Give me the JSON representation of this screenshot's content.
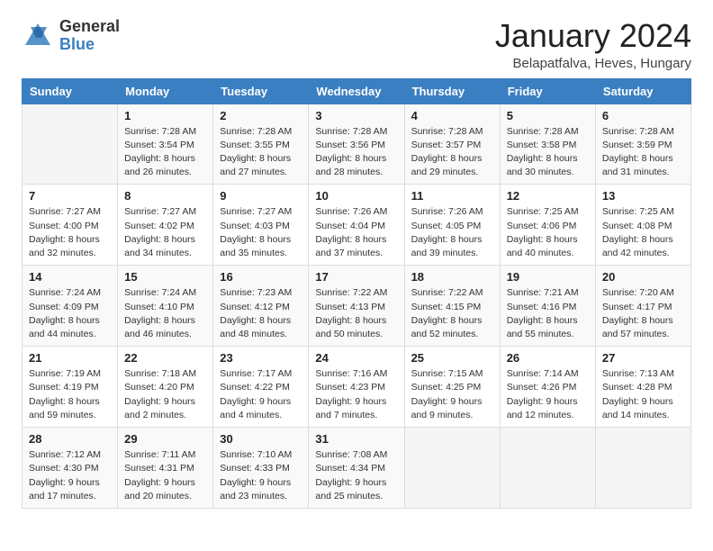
{
  "logo": {
    "general": "General",
    "blue": "Blue"
  },
  "header": {
    "month": "January 2024",
    "location": "Belapatfalva, Heves, Hungary"
  },
  "weekdays": [
    "Sunday",
    "Monday",
    "Tuesday",
    "Wednesday",
    "Thursday",
    "Friday",
    "Saturday"
  ],
  "weeks": [
    [
      {
        "day": "",
        "empty": true
      },
      {
        "day": "1",
        "sunrise": "Sunrise: 7:28 AM",
        "sunset": "Sunset: 3:54 PM",
        "daylight": "Daylight: 8 hours and 26 minutes."
      },
      {
        "day": "2",
        "sunrise": "Sunrise: 7:28 AM",
        "sunset": "Sunset: 3:55 PM",
        "daylight": "Daylight: 8 hours and 27 minutes."
      },
      {
        "day": "3",
        "sunrise": "Sunrise: 7:28 AM",
        "sunset": "Sunset: 3:56 PM",
        "daylight": "Daylight: 8 hours and 28 minutes."
      },
      {
        "day": "4",
        "sunrise": "Sunrise: 7:28 AM",
        "sunset": "Sunset: 3:57 PM",
        "daylight": "Daylight: 8 hours and 29 minutes."
      },
      {
        "day": "5",
        "sunrise": "Sunrise: 7:28 AM",
        "sunset": "Sunset: 3:58 PM",
        "daylight": "Daylight: 8 hours and 30 minutes."
      },
      {
        "day": "6",
        "sunrise": "Sunrise: 7:28 AM",
        "sunset": "Sunset: 3:59 PM",
        "daylight": "Daylight: 8 hours and 31 minutes."
      }
    ],
    [
      {
        "day": "7",
        "sunrise": "Sunrise: 7:27 AM",
        "sunset": "Sunset: 4:00 PM",
        "daylight": "Daylight: 8 hours and 32 minutes."
      },
      {
        "day": "8",
        "sunrise": "Sunrise: 7:27 AM",
        "sunset": "Sunset: 4:02 PM",
        "daylight": "Daylight: 8 hours and 34 minutes."
      },
      {
        "day": "9",
        "sunrise": "Sunrise: 7:27 AM",
        "sunset": "Sunset: 4:03 PM",
        "daylight": "Daylight: 8 hours and 35 minutes."
      },
      {
        "day": "10",
        "sunrise": "Sunrise: 7:26 AM",
        "sunset": "Sunset: 4:04 PM",
        "daylight": "Daylight: 8 hours and 37 minutes."
      },
      {
        "day": "11",
        "sunrise": "Sunrise: 7:26 AM",
        "sunset": "Sunset: 4:05 PM",
        "daylight": "Daylight: 8 hours and 39 minutes."
      },
      {
        "day": "12",
        "sunrise": "Sunrise: 7:25 AM",
        "sunset": "Sunset: 4:06 PM",
        "daylight": "Daylight: 8 hours and 40 minutes."
      },
      {
        "day": "13",
        "sunrise": "Sunrise: 7:25 AM",
        "sunset": "Sunset: 4:08 PM",
        "daylight": "Daylight: 8 hours and 42 minutes."
      }
    ],
    [
      {
        "day": "14",
        "sunrise": "Sunrise: 7:24 AM",
        "sunset": "Sunset: 4:09 PM",
        "daylight": "Daylight: 8 hours and 44 minutes."
      },
      {
        "day": "15",
        "sunrise": "Sunrise: 7:24 AM",
        "sunset": "Sunset: 4:10 PM",
        "daylight": "Daylight: 8 hours and 46 minutes."
      },
      {
        "day": "16",
        "sunrise": "Sunrise: 7:23 AM",
        "sunset": "Sunset: 4:12 PM",
        "daylight": "Daylight: 8 hours and 48 minutes."
      },
      {
        "day": "17",
        "sunrise": "Sunrise: 7:22 AM",
        "sunset": "Sunset: 4:13 PM",
        "daylight": "Daylight: 8 hours and 50 minutes."
      },
      {
        "day": "18",
        "sunrise": "Sunrise: 7:22 AM",
        "sunset": "Sunset: 4:15 PM",
        "daylight": "Daylight: 8 hours and 52 minutes."
      },
      {
        "day": "19",
        "sunrise": "Sunrise: 7:21 AM",
        "sunset": "Sunset: 4:16 PM",
        "daylight": "Daylight: 8 hours and 55 minutes."
      },
      {
        "day": "20",
        "sunrise": "Sunrise: 7:20 AM",
        "sunset": "Sunset: 4:17 PM",
        "daylight": "Daylight: 8 hours and 57 minutes."
      }
    ],
    [
      {
        "day": "21",
        "sunrise": "Sunrise: 7:19 AM",
        "sunset": "Sunset: 4:19 PM",
        "daylight": "Daylight: 8 hours and 59 minutes."
      },
      {
        "day": "22",
        "sunrise": "Sunrise: 7:18 AM",
        "sunset": "Sunset: 4:20 PM",
        "daylight": "Daylight: 9 hours and 2 minutes."
      },
      {
        "day": "23",
        "sunrise": "Sunrise: 7:17 AM",
        "sunset": "Sunset: 4:22 PM",
        "daylight": "Daylight: 9 hours and 4 minutes."
      },
      {
        "day": "24",
        "sunrise": "Sunrise: 7:16 AM",
        "sunset": "Sunset: 4:23 PM",
        "daylight": "Daylight: 9 hours and 7 minutes."
      },
      {
        "day": "25",
        "sunrise": "Sunrise: 7:15 AM",
        "sunset": "Sunset: 4:25 PM",
        "daylight": "Daylight: 9 hours and 9 minutes."
      },
      {
        "day": "26",
        "sunrise": "Sunrise: 7:14 AM",
        "sunset": "Sunset: 4:26 PM",
        "daylight": "Daylight: 9 hours and 12 minutes."
      },
      {
        "day": "27",
        "sunrise": "Sunrise: 7:13 AM",
        "sunset": "Sunset: 4:28 PM",
        "daylight": "Daylight: 9 hours and 14 minutes."
      }
    ],
    [
      {
        "day": "28",
        "sunrise": "Sunrise: 7:12 AM",
        "sunset": "Sunset: 4:30 PM",
        "daylight": "Daylight: 9 hours and 17 minutes."
      },
      {
        "day": "29",
        "sunrise": "Sunrise: 7:11 AM",
        "sunset": "Sunset: 4:31 PM",
        "daylight": "Daylight: 9 hours and 20 minutes."
      },
      {
        "day": "30",
        "sunrise": "Sunrise: 7:10 AM",
        "sunset": "Sunset: 4:33 PM",
        "daylight": "Daylight: 9 hours and 23 minutes."
      },
      {
        "day": "31",
        "sunrise": "Sunrise: 7:08 AM",
        "sunset": "Sunset: 4:34 PM",
        "daylight": "Daylight: 9 hours and 25 minutes."
      },
      {
        "day": "",
        "empty": true
      },
      {
        "day": "",
        "empty": true
      },
      {
        "day": "",
        "empty": true
      }
    ]
  ]
}
